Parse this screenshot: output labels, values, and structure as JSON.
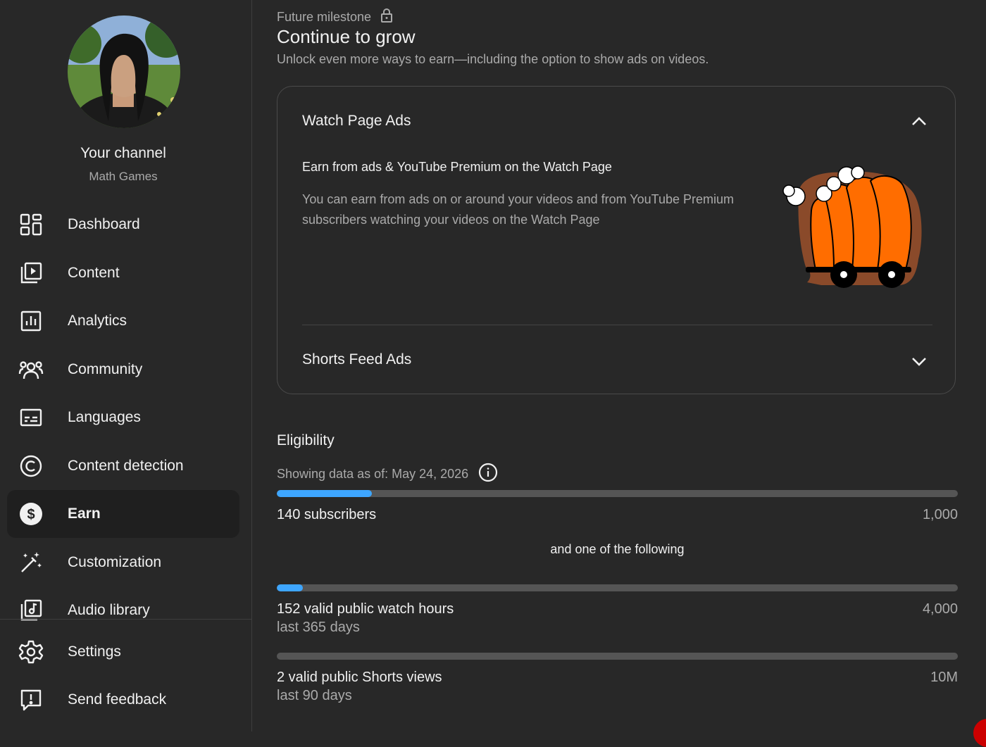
{
  "sidebar": {
    "channel_title": "Your channel",
    "channel_name": "Math Games",
    "items": [
      {
        "label": "Dashboard",
        "icon": "dashboard-icon"
      },
      {
        "label": "Content",
        "icon": "content-icon"
      },
      {
        "label": "Analytics",
        "icon": "analytics-icon"
      },
      {
        "label": "Community",
        "icon": "community-icon"
      },
      {
        "label": "Languages",
        "icon": "subtitles-icon"
      },
      {
        "label": "Content detection",
        "icon": "copyright-icon"
      },
      {
        "label": "Earn",
        "icon": "dollar-icon",
        "active": true
      },
      {
        "label": "Customization",
        "icon": "magic-wand-icon"
      },
      {
        "label": "Audio library",
        "icon": "audio-library-icon"
      }
    ],
    "bottom_items": [
      {
        "label": "Settings",
        "icon": "gear-icon"
      },
      {
        "label": "Send feedback",
        "icon": "feedback-icon"
      }
    ]
  },
  "milestone": {
    "label": "Future milestone",
    "title": "Continue to grow",
    "description": "Unlock even more ways to earn—including the option to show ads on videos."
  },
  "ads_card": {
    "watch_page": {
      "title": "Watch Page Ads",
      "expanded": true,
      "heading": "Earn from ads & YouTube Premium on the Watch Page",
      "description": "You can earn from ads on or around your videos and from YouTube Premium subscribers watching your videos on the Watch Page"
    },
    "shorts_feed": {
      "title": "Shorts Feed Ads",
      "expanded": false
    }
  },
  "eligibility": {
    "title": "Eligibility",
    "date_text": "Showing data as of: May 24, 2026",
    "and_one_text": "and one of the following",
    "bars": [
      {
        "label": "140 subscribers",
        "target": "1,000",
        "sub": "",
        "progress": 0.14
      },
      {
        "label": "152 valid public watch hours",
        "target": "4,000",
        "sub": "last 365 days",
        "progress": 0.038
      },
      {
        "label": "2 valid public Shorts views",
        "target": "10M",
        "sub": "last 90 days",
        "progress": 0.0
      }
    ]
  },
  "colors": {
    "background": "#282828",
    "progress_fill": "#3ea6ff",
    "progress_track": "#555555",
    "text_primary": "#f1f1f1",
    "text_secondary": "#aaaaaa",
    "illustration_orange": "#ff6d00"
  }
}
